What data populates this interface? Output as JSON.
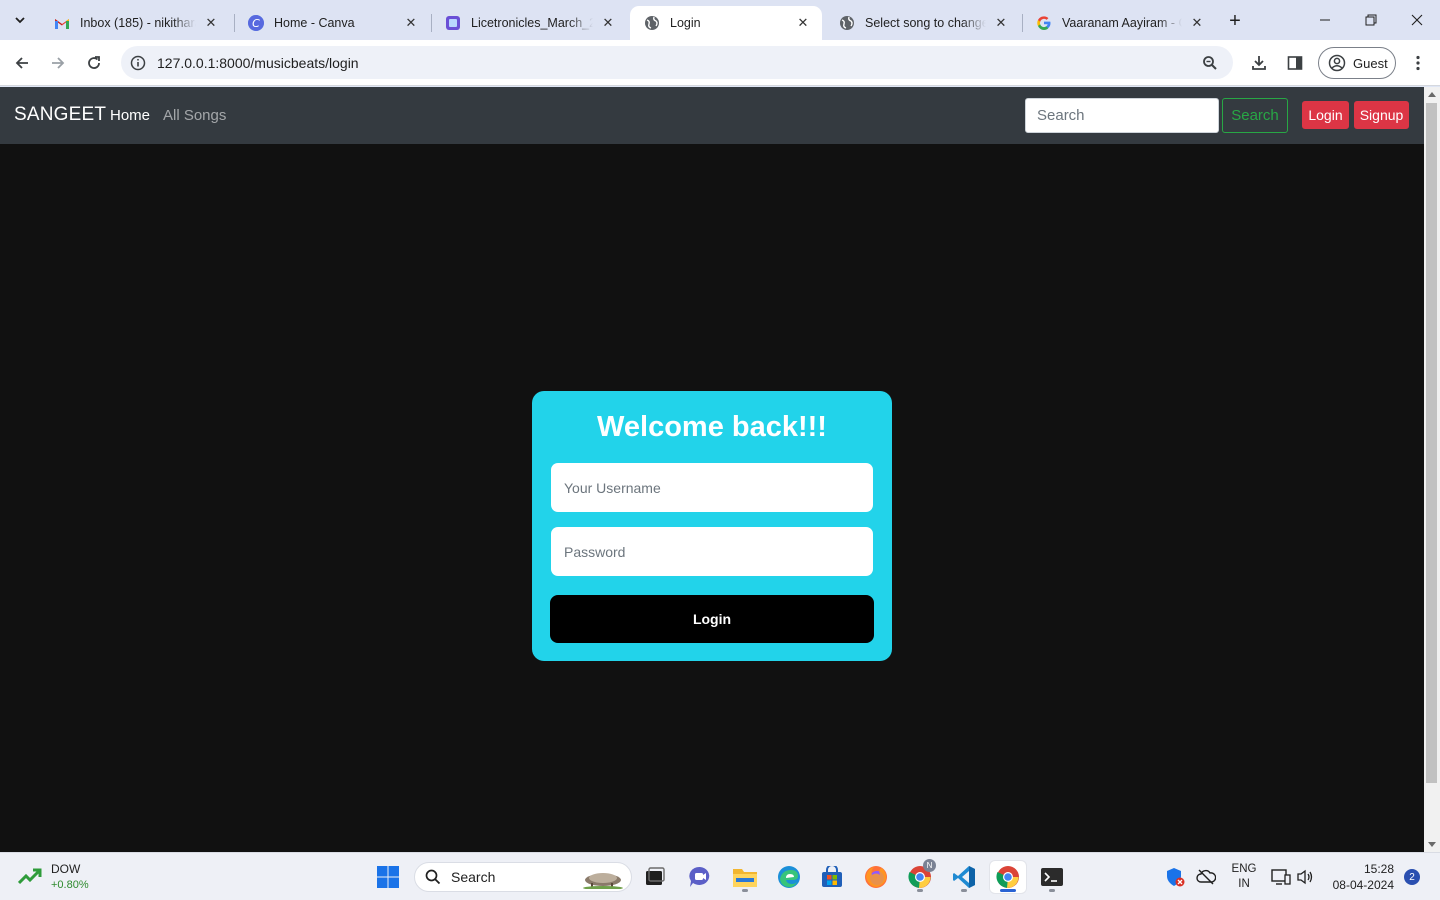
{
  "browser": {
    "tabs": [
      {
        "title": "Inbox (185) - nikitharaj2",
        "icon": "gmail-icon",
        "active": false
      },
      {
        "title": "Home - Canva",
        "icon": "canva-icon",
        "active": false
      },
      {
        "title": "Licetronicles_March_2024",
        "icon": "document-icon",
        "active": false
      },
      {
        "title": "Login",
        "icon": "globe-icon",
        "active": true
      },
      {
        "title": "Select song to change | Django",
        "icon": "globe-icon",
        "active": false
      },
      {
        "title": "Vaaranam Aayiram - Google Search",
        "icon": "google-icon",
        "active": false
      }
    ],
    "url": "127.0.0.1:8000/musicbeats/login",
    "profile_label": "Guest"
  },
  "site": {
    "brand": "SANGEET",
    "nav": {
      "home": "Home",
      "all_songs": "All Songs"
    },
    "search_placeholder": "Search",
    "search_button": "Search",
    "login_button": "Login",
    "signup_button": "Signup",
    "colors": {
      "navbar": "#343a40",
      "accent_red": "#dc3545",
      "accent_green": "#28a745",
      "card": "#22d3ea",
      "page_bg": "#111111"
    }
  },
  "login_form": {
    "heading": "Welcome back!!!",
    "username_placeholder": "Your Username",
    "password_placeholder": "Password",
    "submit_label": "Login"
  },
  "taskbar": {
    "widget_title": "DOW",
    "widget_value": "+0.80%",
    "search_label": "Search",
    "lang_primary": "ENG",
    "lang_secondary": "IN",
    "time": "15:28",
    "date": "08-04-2024",
    "notification_count": "2",
    "chrome_badge": "N"
  }
}
